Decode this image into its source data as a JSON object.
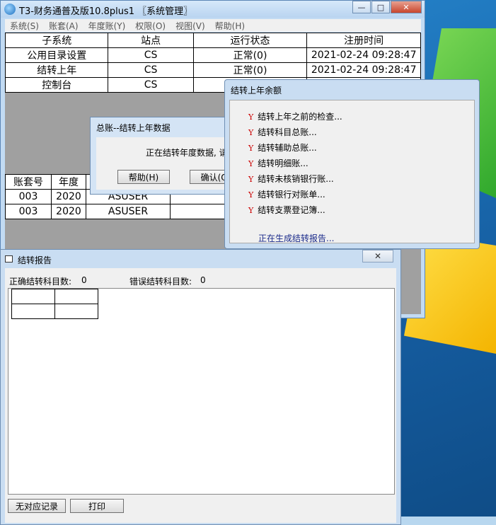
{
  "window": {
    "title": "T3-财务通普及版10.8plus1 〖系统管理〗",
    "min_label": "—",
    "max_label": "□",
    "close_label": "✕"
  },
  "menu": [
    "系统(S)",
    "账套(A)",
    "年度账(Y)",
    "权限(O)",
    "视图(V)",
    "帮助(H)"
  ],
  "subsystems": {
    "headers": [
      "子系统",
      "站点",
      "运行状态",
      "注册时间"
    ],
    "rows": [
      [
        "公用目录设置",
        "CS",
        "正常(0)",
        "2021-02-24 09:28:47"
      ],
      [
        "结转上年",
        "CS",
        "正常(0)",
        "2021-02-24 09:28:47"
      ],
      [
        "控制台",
        "CS",
        "",
        ""
      ]
    ]
  },
  "accounts": {
    "headers": [
      "账套号",
      "年度"
    ],
    "rows": [
      [
        "003",
        "2020",
        "ASUSER"
      ],
      [
        "003",
        "2020",
        "ASUSER"
      ]
    ]
  },
  "dialog_zz": {
    "title": "总账--结转上年数据",
    "message": "正在结转年度数据, 请",
    "help_button": "帮助(H)",
    "ok_button": "确认(O)"
  },
  "dialog_ye": {
    "title": "结转上年余额",
    "steps": [
      "结转上年之前的检查...",
      "结转科目总账...",
      "结转辅助总账...",
      "结转明细账...",
      "结转未核销银行账...",
      "结转银行对账单...",
      "结转支票登记簿..."
    ],
    "step_mark": "Y",
    "status": "正在生成结转报告..."
  },
  "report": {
    "title": "结转报告",
    "close_label": "✕",
    "correct_label": "正确结转科目数:",
    "correct_count": "0",
    "error_label": "错误结转科目数:",
    "error_count": "0",
    "no_record_button": "无对应记录",
    "print_button": "打印"
  }
}
